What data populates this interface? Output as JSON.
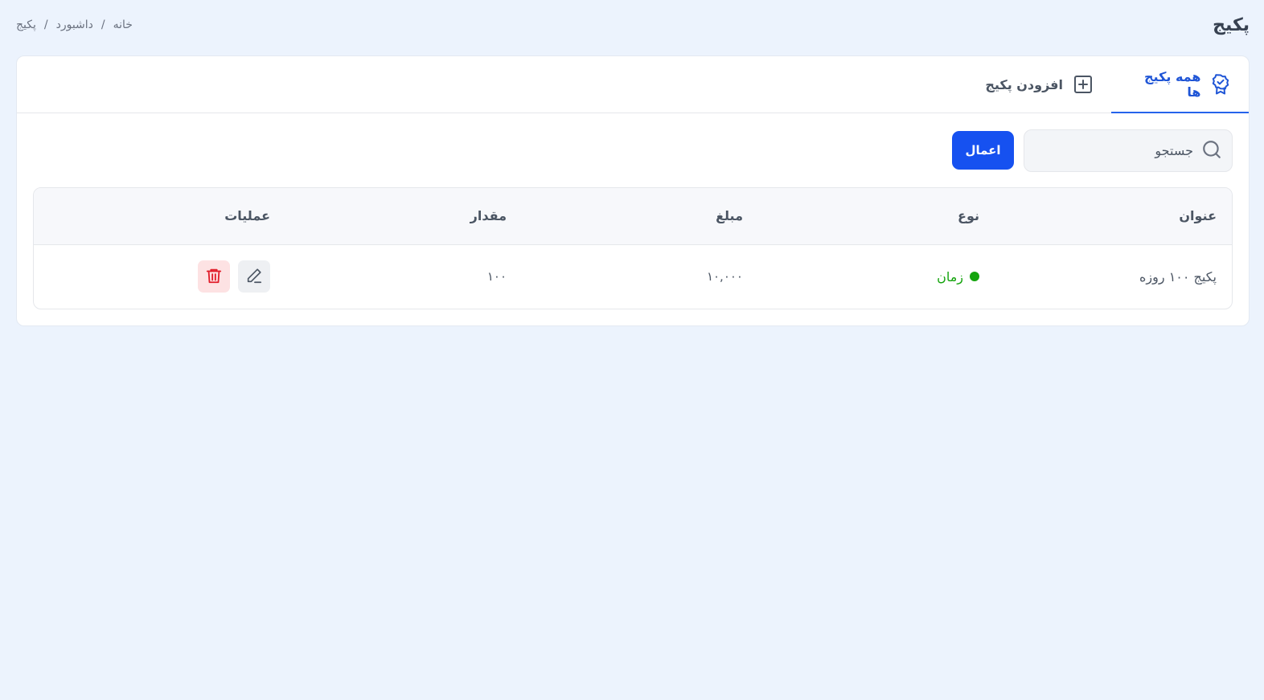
{
  "page": {
    "title": "پکیج"
  },
  "breadcrumb": [
    "خانه",
    "داشبورد",
    "پکیج"
  ],
  "tabs": [
    {
      "label": "همه پکیج ها",
      "icon": "badge-check-icon",
      "active": true
    },
    {
      "label": "افزودن پکیج",
      "icon": "plus-square-icon",
      "active": false
    }
  ],
  "search": {
    "placeholder": "جستجو",
    "value": ""
  },
  "apply_label": "اعمال",
  "table": {
    "headers": [
      "عنوان",
      "نوع",
      "مبلغ",
      "مقدار",
      "عملیات"
    ],
    "rows": [
      {
        "title": "پکیج ۱۰۰ روزه",
        "type": "زمان",
        "amount": "۱۰,۰۰۰",
        "quantity": "۱۰۰"
      }
    ]
  },
  "colors": {
    "accent": "#1651f0",
    "type_active": "#14a40d",
    "danger": "#e11d2a",
    "background": "#ecf3fd"
  }
}
